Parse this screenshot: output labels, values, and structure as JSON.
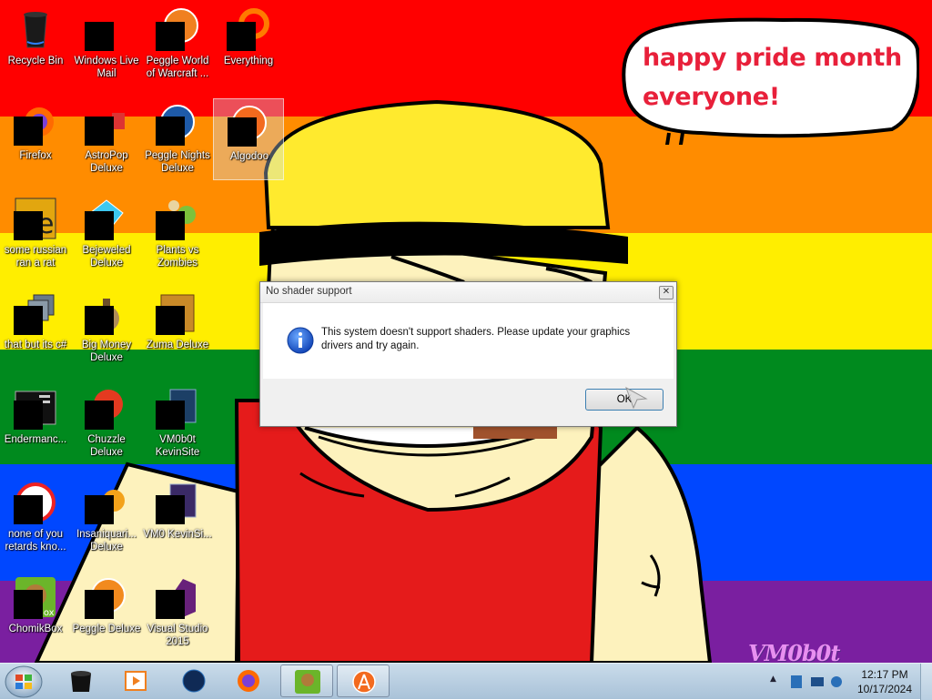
{
  "wallpaper": {
    "stripe_colors": [
      "#ff0000",
      "#ff8c00",
      "#ffee00",
      "#008a1e",
      "#0047ff",
      "#7a1fa0"
    ],
    "speech_bubble": "happy pride month everyone!",
    "signature": "VM0b0t"
  },
  "desktop_icons": [
    {
      "label": "Recycle Bin",
      "icon": "recycle-bin-icon"
    },
    {
      "label": "Windows Live Mail",
      "icon": "windows-live-mail-icon"
    },
    {
      "label": "Peggle World of Warcraft ...",
      "icon": "peggle-wow-icon"
    },
    {
      "label": "Everything",
      "icon": "everything-search-icon"
    },
    {
      "label": "Firefox",
      "icon": "firefox-icon"
    },
    {
      "label": "AstroPop Deluxe",
      "icon": "astropop-icon"
    },
    {
      "label": "Peggle Nights Deluxe",
      "icon": "peggle-nights-icon"
    },
    {
      "label": "Algodoo",
      "icon": "algodoo-icon"
    },
    {
      "label": "some russian ran a rat",
      "icon": "shortcut-icon"
    },
    {
      "label": "Bejeweled Deluxe",
      "icon": "bejeweled-icon"
    },
    {
      "label": "Plants vs Zombies",
      "icon": "plants-vs-zombies-icon"
    },
    {
      "label": "that but its c#",
      "icon": "shortcut-icon"
    },
    {
      "label": "Big Money Deluxe",
      "icon": "big-money-icon"
    },
    {
      "label": "Zuma Deluxe",
      "icon": "zuma-icon"
    },
    {
      "label": "Endermanc...",
      "icon": "console-icon"
    },
    {
      "label": "Chuzzle Deluxe",
      "icon": "chuzzle-icon"
    },
    {
      "label": "VM0b0t KevinSite",
      "icon": "website-shortcut-icon"
    },
    {
      "label": "none of you retards kno...",
      "icon": "shortcut-icon"
    },
    {
      "label": "Insaniquari... Deluxe",
      "icon": "insaniquarium-icon"
    },
    {
      "label": "VM0 KevinSi...",
      "icon": "website-shortcut-icon"
    },
    {
      "label": "ChomikBox",
      "icon": "chomikbox-icon"
    },
    {
      "label": "Peggle Deluxe",
      "icon": "peggle-icon"
    },
    {
      "label": "Visual Studio 2015",
      "icon": "visual-studio-icon"
    }
  ],
  "dialog": {
    "title": "No shader support",
    "message": "This system doesn't support shaders. Please update your graphics drivers and try again.",
    "ok_label": "OK",
    "icon": "information-icon"
  },
  "taskbar": {
    "start": "windows-start-orb",
    "items": [
      {
        "name": "pinned-app-black-icon"
      },
      {
        "name": "media-player-icon"
      },
      {
        "name": "globe-icon"
      },
      {
        "name": "firefox-icon"
      },
      {
        "name": "chomikbox-icon"
      },
      {
        "name": "algodoo-icon"
      }
    ],
    "tray_overflow": "▲",
    "clock_time": "12:17 PM",
    "clock_date": "10/17/2024"
  }
}
